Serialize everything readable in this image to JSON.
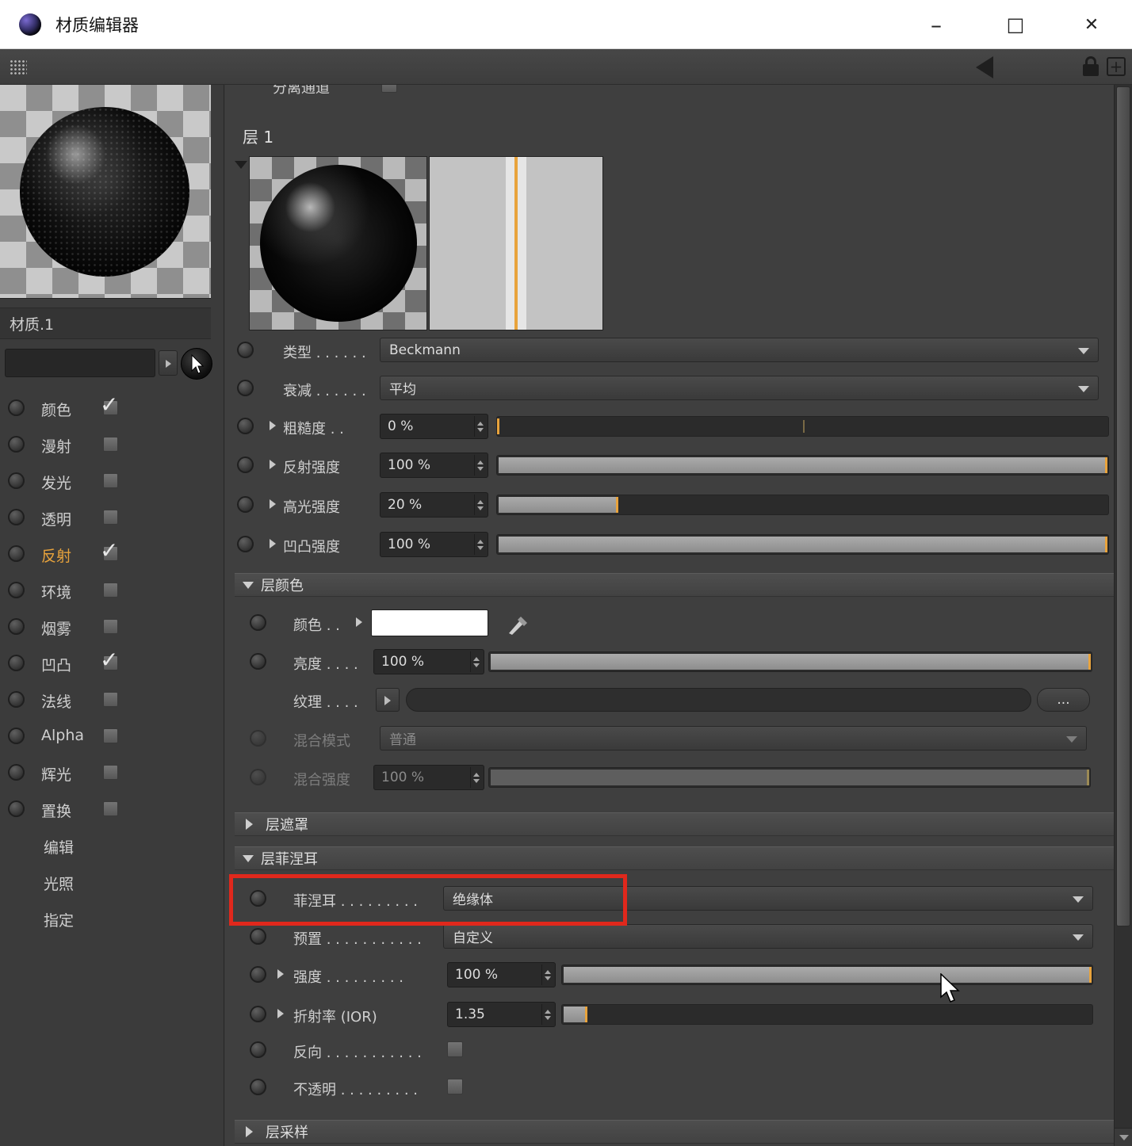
{
  "window": {
    "title": "材质编辑器"
  },
  "left_panel": {
    "material_name": "材质.1",
    "search_value": "",
    "channels": [
      {
        "label": "颜色",
        "checked": true,
        "active": false
      },
      {
        "label": "漫射",
        "checked": false,
        "active": false
      },
      {
        "label": "发光",
        "checked": false,
        "active": false
      },
      {
        "label": "透明",
        "checked": false,
        "active": false
      },
      {
        "label": "反射",
        "checked": true,
        "active": true
      },
      {
        "label": "环境",
        "checked": false,
        "active": false
      },
      {
        "label": "烟雾",
        "checked": false,
        "active": false
      },
      {
        "label": "凹凸",
        "checked": true,
        "active": false
      },
      {
        "label": "法线",
        "checked": false,
        "active": false
      },
      {
        "label": "Alpha",
        "checked": false,
        "active": false
      },
      {
        "label": "辉光",
        "checked": false,
        "active": false
      },
      {
        "label": "置换",
        "checked": false,
        "active": false
      }
    ],
    "actions": [
      {
        "label": "编辑"
      },
      {
        "label": "光照"
      },
      {
        "label": "指定"
      }
    ]
  },
  "main": {
    "separate_pass_label": "分离通道",
    "layer_title": "层 1",
    "rows": {
      "type": {
        "label": "类型 . . . . . .",
        "value": "Beckmann"
      },
      "attenuation": {
        "label": "衰减 . . . . . .",
        "value": "平均"
      },
      "roughness": {
        "label": "粗糙度 . .",
        "value": "0 %",
        "percent": 0
      },
      "reflection_strength": {
        "label": "反射强度",
        "value": "100 %",
        "percent": 100
      },
      "specular_strength": {
        "label": "高光强度",
        "value": "20 %",
        "percent": 20
      },
      "bump_strength": {
        "label": "凹凸强度",
        "value": "100 %",
        "percent": 100
      }
    },
    "layer_color": {
      "title": "层颜色",
      "color": {
        "label": "颜色 . .",
        "swatch": "#ffffff"
      },
      "brightness": {
        "label": "亮度 . . . .",
        "value": "100 %",
        "percent": 100
      },
      "texture": {
        "label": "纹理 . . . .",
        "value": "",
        "button": "..."
      },
      "mix_mode": {
        "label": "混合模式",
        "value": "普通"
      },
      "mix_strength": {
        "label": "混合强度",
        "value": "100 %",
        "percent": 100
      }
    },
    "layer_mask": {
      "title": "层遮罩"
    },
    "layer_fresnel": {
      "title": "层菲涅耳",
      "fresnel": {
        "label": "菲涅耳 . . . . . . . . .",
        "value": "绝缘体"
      },
      "preset": {
        "label": "预置 . . . . . . . . . . .",
        "value": "自定义"
      },
      "strength": {
        "label": "强度 . . . . . . . . .",
        "value": "100 %",
        "percent": 100
      },
      "ior": {
        "label": "折射率  (IOR)",
        "value": "1.35",
        "percent": 5
      },
      "inverted": {
        "label": "反向 . . . . . . . . . . .",
        "checked": false
      },
      "opaque": {
        "label": "不透明 . . . . . . . . .",
        "checked": false
      }
    },
    "layer_sampling": {
      "title": "层采样"
    }
  },
  "annotation": {
    "highlight_color": "#e0281c"
  }
}
